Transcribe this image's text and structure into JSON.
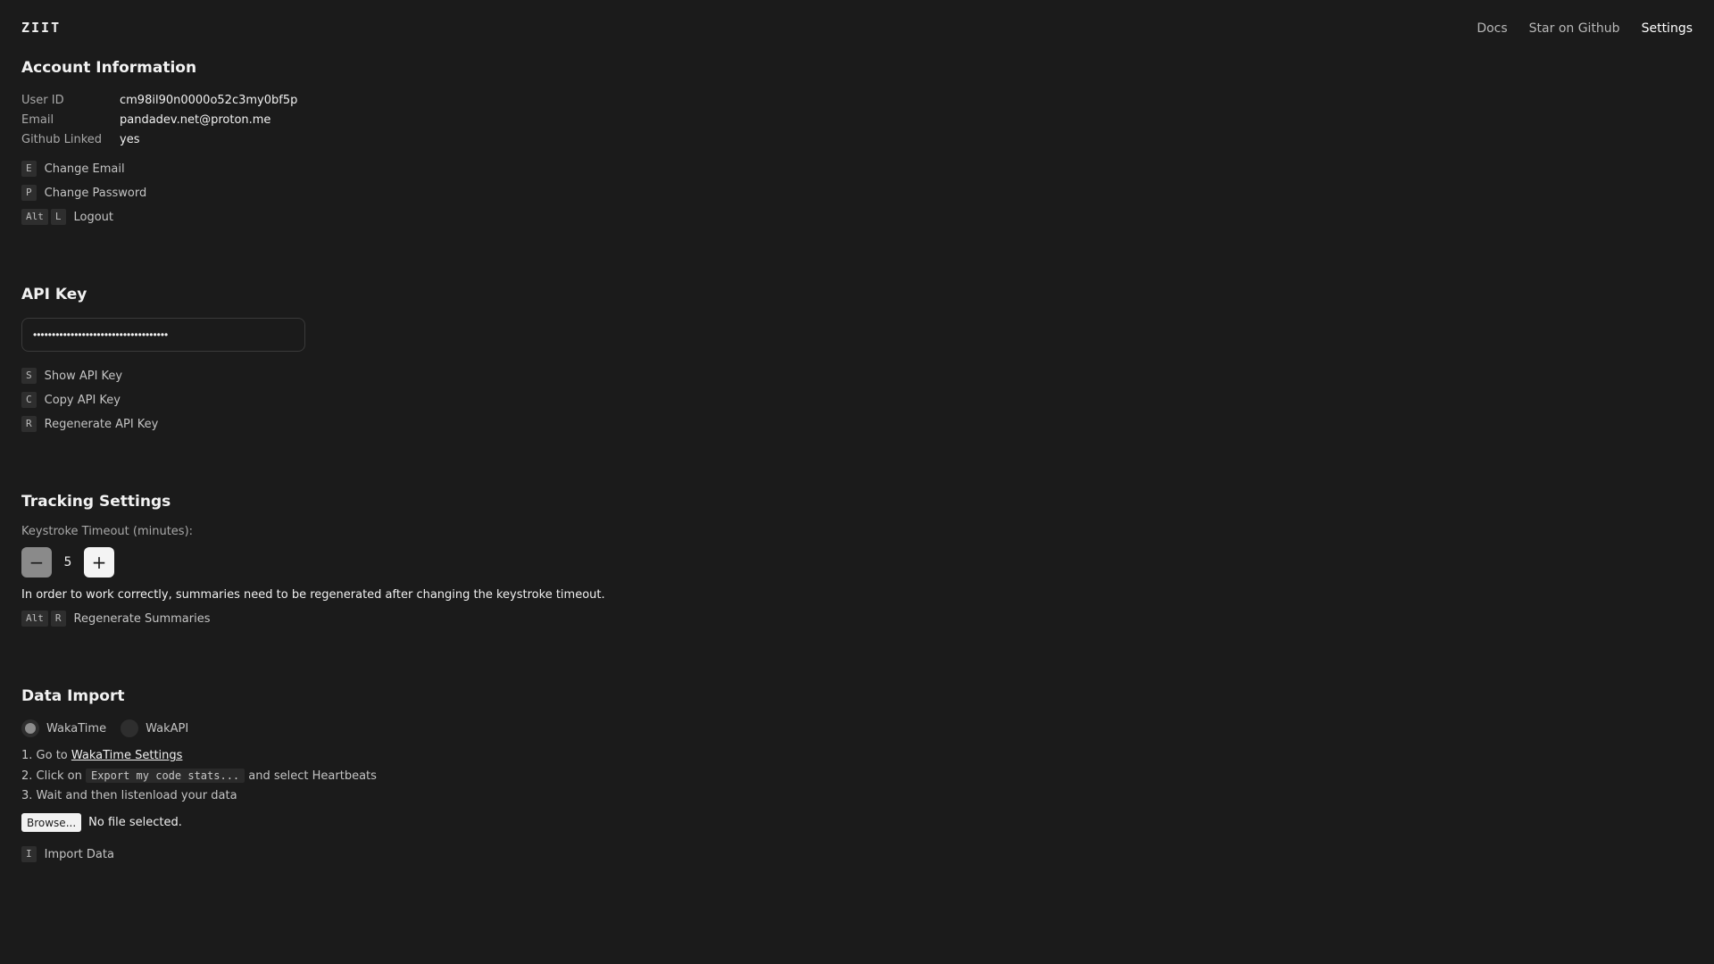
{
  "app": {
    "logo": "ZIIT"
  },
  "nav": {
    "docs": "Docs",
    "github": "Star on Github",
    "settings": "Settings"
  },
  "account": {
    "title": "Account Information",
    "rows": [
      {
        "label": "User ID",
        "value": "cm98il90n0000o52c3my0bf5p"
      },
      {
        "label": "Email",
        "value": "pandadev.net@proton.me"
      },
      {
        "label": "Github Linked",
        "value": "yes"
      }
    ],
    "actions": [
      {
        "keys": [
          "E"
        ],
        "label": "Change Email"
      },
      {
        "keys": [
          "P"
        ],
        "label": "Change Password"
      },
      {
        "keys": [
          "Alt",
          "L"
        ],
        "label": "Logout"
      }
    ]
  },
  "api_key": {
    "title": "API Key",
    "masked_value": "••••••••••••••••••••••••••••••••••••",
    "actions": [
      {
        "keys": [
          "S"
        ],
        "label": "Show API Key"
      },
      {
        "keys": [
          "C"
        ],
        "label": "Copy API Key"
      },
      {
        "keys": [
          "R"
        ],
        "label": "Regenerate API Key"
      }
    ]
  },
  "tracking": {
    "title": "Tracking Settings",
    "timeout_label": "Keystroke Timeout (minutes):",
    "timeout_value": "5",
    "minus": "−",
    "plus": "+",
    "note": "In order to work correctly, summaries need to be regenerated after changing the keystroke timeout.",
    "action": {
      "keys": [
        "Alt",
        "R"
      ],
      "label": "Regenerate Summaries"
    }
  },
  "import": {
    "title": "Data Import",
    "options": [
      {
        "label": "WakaTime",
        "checked": true
      },
      {
        "label": "WakAPI",
        "checked": false
      }
    ],
    "step1_prefix": "1. Go to ",
    "step1_link": "WakaTime Settings",
    "step2_prefix": "2. Click on ",
    "step2_code": "Export my code stats...",
    "step2_suffix": " and select Heartbeats",
    "step3": "3. Wait and then listenload your data",
    "browse": "Browse...",
    "no_file": "No file selected.",
    "action": {
      "keys": [
        "I"
      ],
      "label": "Import Data"
    }
  }
}
